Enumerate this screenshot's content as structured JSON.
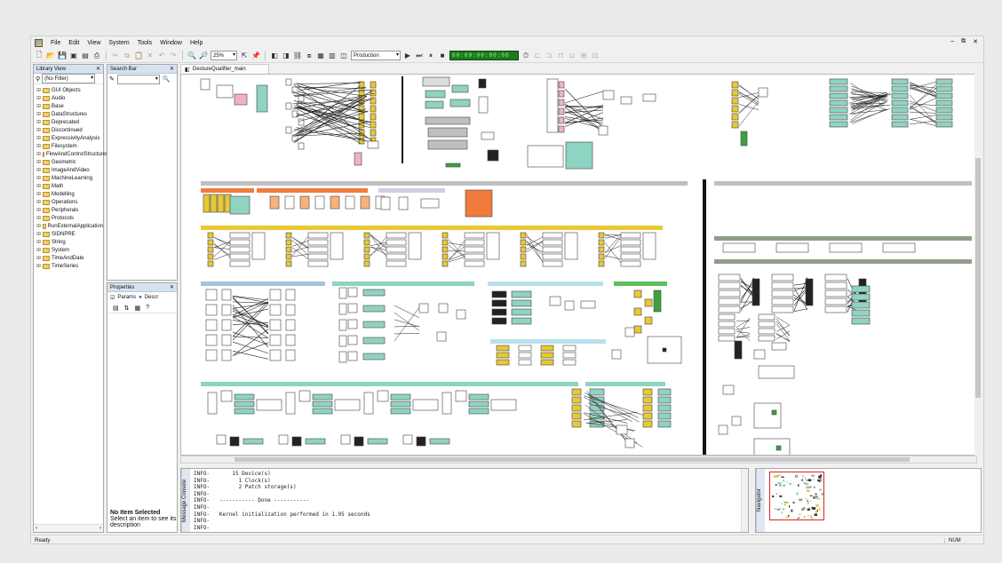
{
  "menu": {
    "items": [
      "File",
      "Edit",
      "View",
      "System",
      "Tools",
      "Window",
      "Help"
    ],
    "window_controls": [
      "–",
      "⧉",
      "✕"
    ]
  },
  "toolbar": {
    "zoom_value": "25%",
    "mode_value": "Production",
    "time_display": "00:00:00:00:00"
  },
  "library": {
    "title": "Library View",
    "filter_value": "(No Filter)",
    "items": [
      "GUI Objects",
      "Audio",
      "Base",
      "DataStructures",
      "Deprecated",
      "Discontinued",
      "ExpressivityAnalysis",
      "Filesystem",
      "FlowAndControlStructures",
      "Geometric",
      "ImageAndVideo",
      "MachineLearning",
      "Math",
      "Modelling",
      "Operations",
      "Peripherals",
      "Protocols",
      "RunExternalApplication",
      "SIDNPRE",
      "String",
      "System",
      "TimeAndDate",
      "TimeSeries"
    ]
  },
  "search": {
    "title": "Search Bar"
  },
  "properties": {
    "title": "Properties",
    "tab_params": "Params",
    "tab_descr": "Descr",
    "no_item_title": "No Item Selected",
    "no_item_text": "Select an item to see its description"
  },
  "document": {
    "tab_label": "GestureQualifier_main"
  },
  "console": {
    "label": "Message Console",
    "lines": [
      "INFO-       15 Device(s)",
      "INFO-         1 Clock(s)",
      "INFO-         2 Patch storage(s)",
      "INFO-",
      "INFO-   ----------- Done -----------",
      "INFO-",
      "INFO-   Kernel initialization performed in 1.95 seconds",
      "INFO-",
      "INFO-"
    ]
  },
  "navigator": {
    "label": "Navigator"
  },
  "status": {
    "left": "Ready",
    "right": "NUM"
  }
}
